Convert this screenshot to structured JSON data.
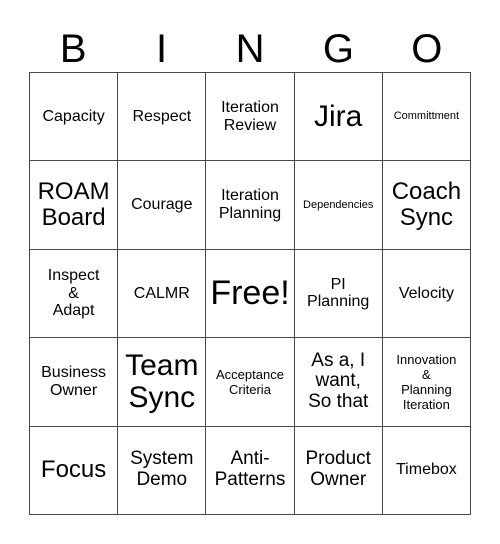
{
  "card": {
    "title_letters": [
      "B",
      "I",
      "N",
      "G",
      "O"
    ],
    "border_color": "#4a4a4a",
    "background_color": "#ffffff",
    "text_color": "#000000",
    "rows": [
      [
        {
          "text": "Capacity",
          "size": "s"
        },
        {
          "text": "Respect",
          "size": "s"
        },
        {
          "text": "Iteration\nReview",
          "size": "s"
        },
        {
          "text": "Jira",
          "size": "xl"
        },
        {
          "text": "Committment",
          "size": "xxs"
        }
      ],
      [
        {
          "text": "ROAM\nBoard",
          "size": "l"
        },
        {
          "text": "Courage",
          "size": "s"
        },
        {
          "text": "Iteration\nPlanning",
          "size": "s"
        },
        {
          "text": "Dependencies",
          "size": "xxs"
        },
        {
          "text": "Coach\nSync",
          "size": "l"
        }
      ],
      [
        {
          "text": "Inspect\n&\nAdapt",
          "size": "s"
        },
        {
          "text": "CALMR",
          "size": "s"
        },
        {
          "text": "Free!",
          "size": "xxl"
        },
        {
          "text": "PI\nPlanning",
          "size": "s"
        },
        {
          "text": "Velocity",
          "size": "s"
        }
      ],
      [
        {
          "text": "Business\nOwner",
          "size": "s"
        },
        {
          "text": "Team\nSync",
          "size": "xl"
        },
        {
          "text": "Acceptance\nCriteria",
          "size": "xs"
        },
        {
          "text": "As a, I\nwant,\nSo that",
          "size": "m"
        },
        {
          "text": "Innovation\n&\nPlanning\nIteration",
          "size": "xs"
        }
      ],
      [
        {
          "text": "Focus",
          "size": "l"
        },
        {
          "text": "System\nDemo",
          "size": "m"
        },
        {
          "text": "Anti-\nPatterns",
          "size": "m"
        },
        {
          "text": "Product\nOwner",
          "size": "m"
        },
        {
          "text": "Timebox",
          "size": "s"
        }
      ]
    ]
  }
}
